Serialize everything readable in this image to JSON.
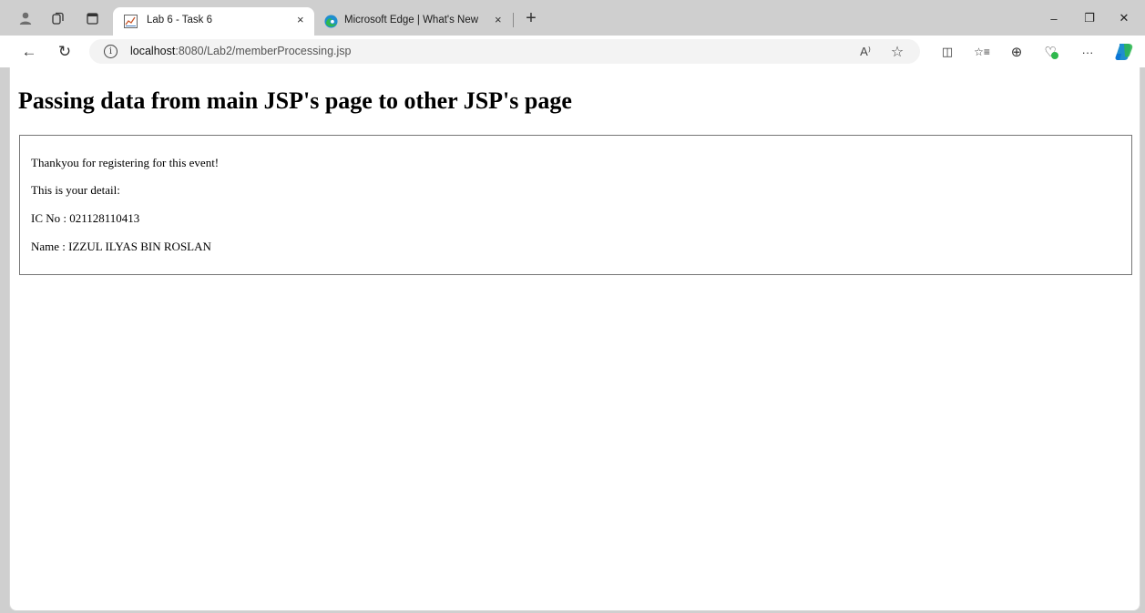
{
  "browser": {
    "tabs": [
      {
        "title": "Lab 6 - Task 6",
        "close": "×",
        "active": true
      },
      {
        "title": "Microsoft Edge | What's New",
        "close": "×",
        "active": false
      }
    ],
    "new_tab": "+",
    "window_controls": {
      "minimize": "–",
      "restore": "❐",
      "close": "✕"
    },
    "nav": {
      "back": "←",
      "refresh": "↻"
    },
    "address": {
      "host": "localhost",
      "rest": ":8080/Lab2/memberProcessing.jsp"
    },
    "address_icons": {
      "read_aloud": "A⁾",
      "favorite": "☆"
    },
    "toolbar_icons": {
      "split_screen": "◫",
      "favorites": "☆≡",
      "collections": "⊕",
      "performance": "♡",
      "more": "···"
    },
    "colors": {
      "accent": "#0b76d6",
      "edge_blue": "#1f8ecf",
      "edge_green": "#2fb84d"
    }
  },
  "page": {
    "heading": "Passing data from main JSP's page to other JSP's page",
    "lines": [
      "Thankyou for registering for this event!",
      "This is your detail:",
      "IC No : 021128110413",
      "Name : IZZUL ILYAS BIN ROSLAN"
    ]
  }
}
